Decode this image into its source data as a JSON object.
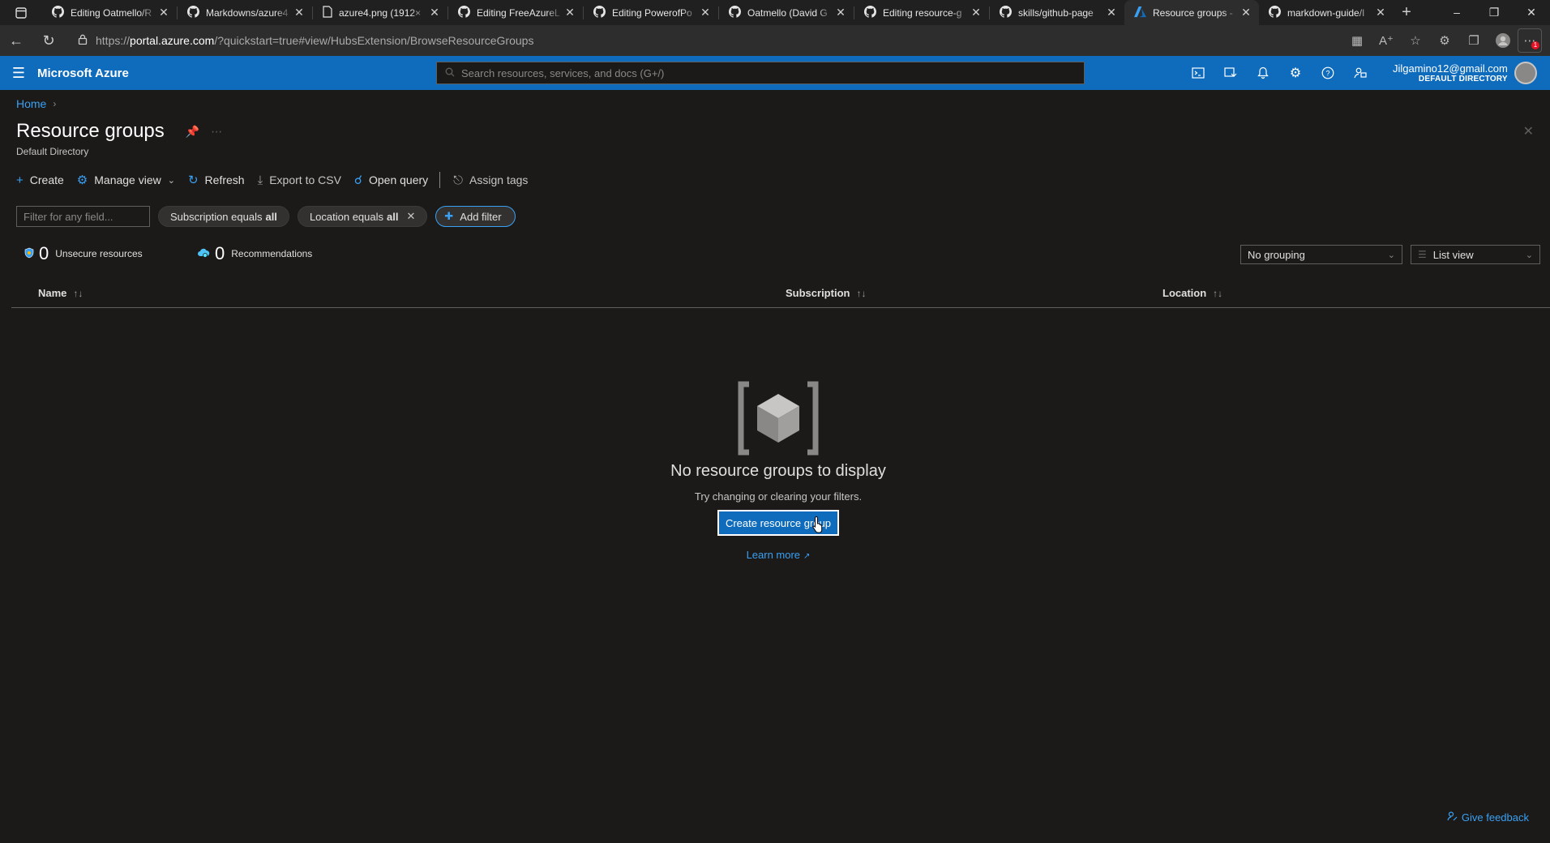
{
  "browser": {
    "tabs": [
      {
        "title": "Editing Oatmello/R",
        "icon": "github-icon",
        "active": false
      },
      {
        "title": "Markdowns/azure4",
        "icon": "github-icon",
        "active": false
      },
      {
        "title": "azure4.png (1912×",
        "icon": "document-icon",
        "active": false
      },
      {
        "title": "Editing FreeAzureL",
        "icon": "github-icon",
        "active": false
      },
      {
        "title": "Editing PowerofPo",
        "icon": "github-icon",
        "active": false
      },
      {
        "title": "Oatmello (David G",
        "icon": "github-icon",
        "active": false
      },
      {
        "title": "Editing resource-g",
        "icon": "github-icon",
        "active": false
      },
      {
        "title": "skills/github-page",
        "icon": "github-icon",
        "active": false
      },
      {
        "title": "Resource groups -",
        "icon": "azure-icon",
        "active": true
      },
      {
        "title": "markdown-guide/I",
        "icon": "github-icon",
        "active": false
      }
    ],
    "url_prefix": "https://",
    "url_host": "portal.azure.com",
    "url_path": "/?quickstart=true#view/HubsExtension/BrowseResourceGroups",
    "profile_badge": "1"
  },
  "header": {
    "brand": "Microsoft Azure",
    "search_placeholder": "Search resources, services, and docs (G+/)",
    "account_email": "Jilgamino12@gmail.com",
    "account_directory": "DEFAULT DIRECTORY"
  },
  "page": {
    "breadcrumb_home": "Home",
    "title": "Resource groups",
    "subtitle": "Default Directory"
  },
  "commands": {
    "create": "Create",
    "manage_view": "Manage view",
    "refresh": "Refresh",
    "export_csv": "Export to CSV",
    "open_query": "Open query",
    "assign_tags": "Assign tags"
  },
  "filters": {
    "placeholder": "Filter for any field...",
    "subscription_label": "Subscription equals",
    "subscription_value": "all",
    "location_label": "Location equals",
    "location_value": "all",
    "add_filter": "Add filter"
  },
  "summary": {
    "unsecure_count": "0",
    "unsecure_label": "Unsecure resources",
    "recommendations_count": "0",
    "recommendations_label": "Recommendations"
  },
  "view_options": {
    "grouping": "No grouping",
    "view": "List view"
  },
  "table": {
    "columns": [
      "Name",
      "Subscription",
      "Location"
    ]
  },
  "empty_state": {
    "title": "No resource groups to display",
    "subtitle": "Try changing or clearing your filters.",
    "create_button": "Create resource group",
    "learn_more": "Learn more"
  },
  "footer": {
    "feedback": "Give feedback"
  },
  "colors": {
    "azure_blue": "#0f6cbd",
    "link_blue": "#3aa0f3",
    "background": "#1b1a19"
  }
}
